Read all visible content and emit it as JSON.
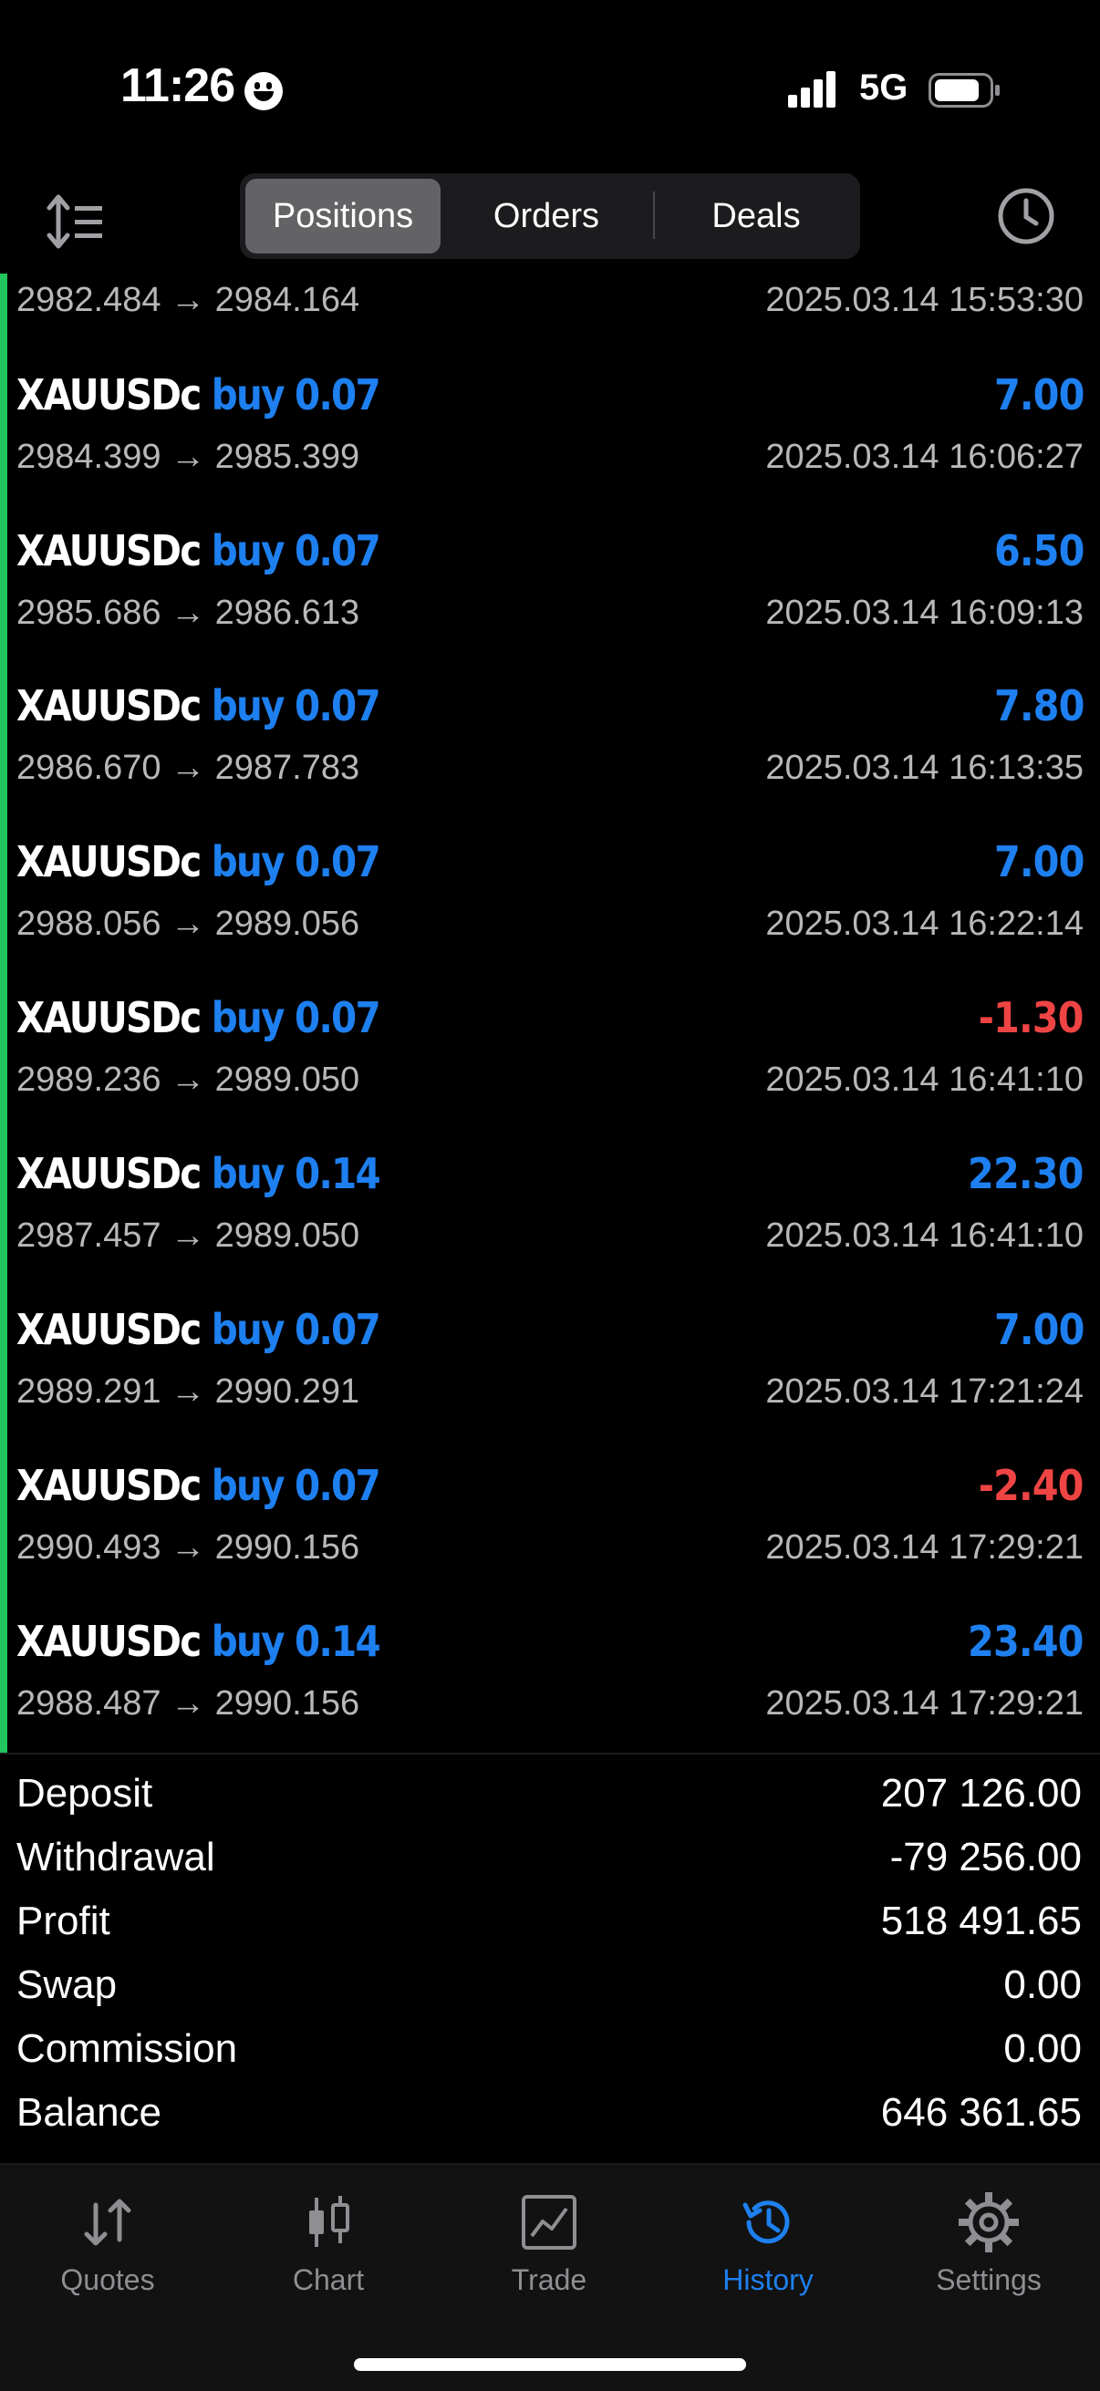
{
  "status_bar": {
    "time": "11:26",
    "network": "5G"
  },
  "tabs_top": {
    "positions": "Positions",
    "orders": "Orders",
    "deals": "Deals",
    "active": "positions"
  },
  "colors": {
    "accent": "#1e80f0",
    "loss": "#ef4444",
    "indicator": "#22c55e"
  },
  "partial_row": {
    "prices": "2982.484 → 2984.164",
    "time": "2025.03.14 15:53:30"
  },
  "trades": [
    {
      "symbol": "XAUUSDc",
      "side": "buy 0.07",
      "profit": "7.00",
      "prices": "2984.399 → 2985.399",
      "time": "2025.03.14 16:06:27"
    },
    {
      "symbol": "XAUUSDc",
      "side": "buy 0.07",
      "profit": "6.50",
      "prices": "2985.686 → 2986.613",
      "time": "2025.03.14 16:09:13"
    },
    {
      "symbol": "XAUUSDc",
      "side": "buy 0.07",
      "profit": "7.80",
      "prices": "2986.670 → 2987.783",
      "time": "2025.03.14 16:13:35"
    },
    {
      "symbol": "XAUUSDc",
      "side": "buy 0.07",
      "profit": "7.00",
      "prices": "2988.056 → 2989.056",
      "time": "2025.03.14 16:22:14"
    },
    {
      "symbol": "XAUUSDc",
      "side": "buy 0.07",
      "profit": "-1.30",
      "prices": "2989.236 → 2989.050",
      "time": "2025.03.14 16:41:10"
    },
    {
      "symbol": "XAUUSDc",
      "side": "buy 0.14",
      "profit": "22.30",
      "prices": "2987.457 → 2989.050",
      "time": "2025.03.14 16:41:10"
    },
    {
      "symbol": "XAUUSDc",
      "side": "buy 0.07",
      "profit": "7.00",
      "prices": "2989.291 → 2990.291",
      "time": "2025.03.14 17:21:24"
    },
    {
      "symbol": "XAUUSDc",
      "side": "buy 0.07",
      "profit": "-2.40",
      "prices": "2990.493 → 2990.156",
      "time": "2025.03.14 17:29:21"
    },
    {
      "symbol": "XAUUSDc",
      "side": "buy 0.14",
      "profit": "23.40",
      "prices": "2988.487 → 2990.156",
      "time": "2025.03.14 17:29:21"
    }
  ],
  "summary": {
    "deposit_label": "Deposit",
    "deposit": "207 126.00",
    "withdrawal_label": "Withdrawal",
    "withdrawal": "-79 256.00",
    "profit_label": "Profit",
    "profit": "518 491.65",
    "swap_label": "Swap",
    "swap": "0.00",
    "commission_label": "Commission",
    "commission": "0.00",
    "balance_label": "Balance",
    "balance": "646 361.65"
  },
  "tab_bar": {
    "quotes": "Quotes",
    "chart": "Chart",
    "trade": "Trade",
    "history": "History",
    "settings": "Settings",
    "active": "history"
  }
}
